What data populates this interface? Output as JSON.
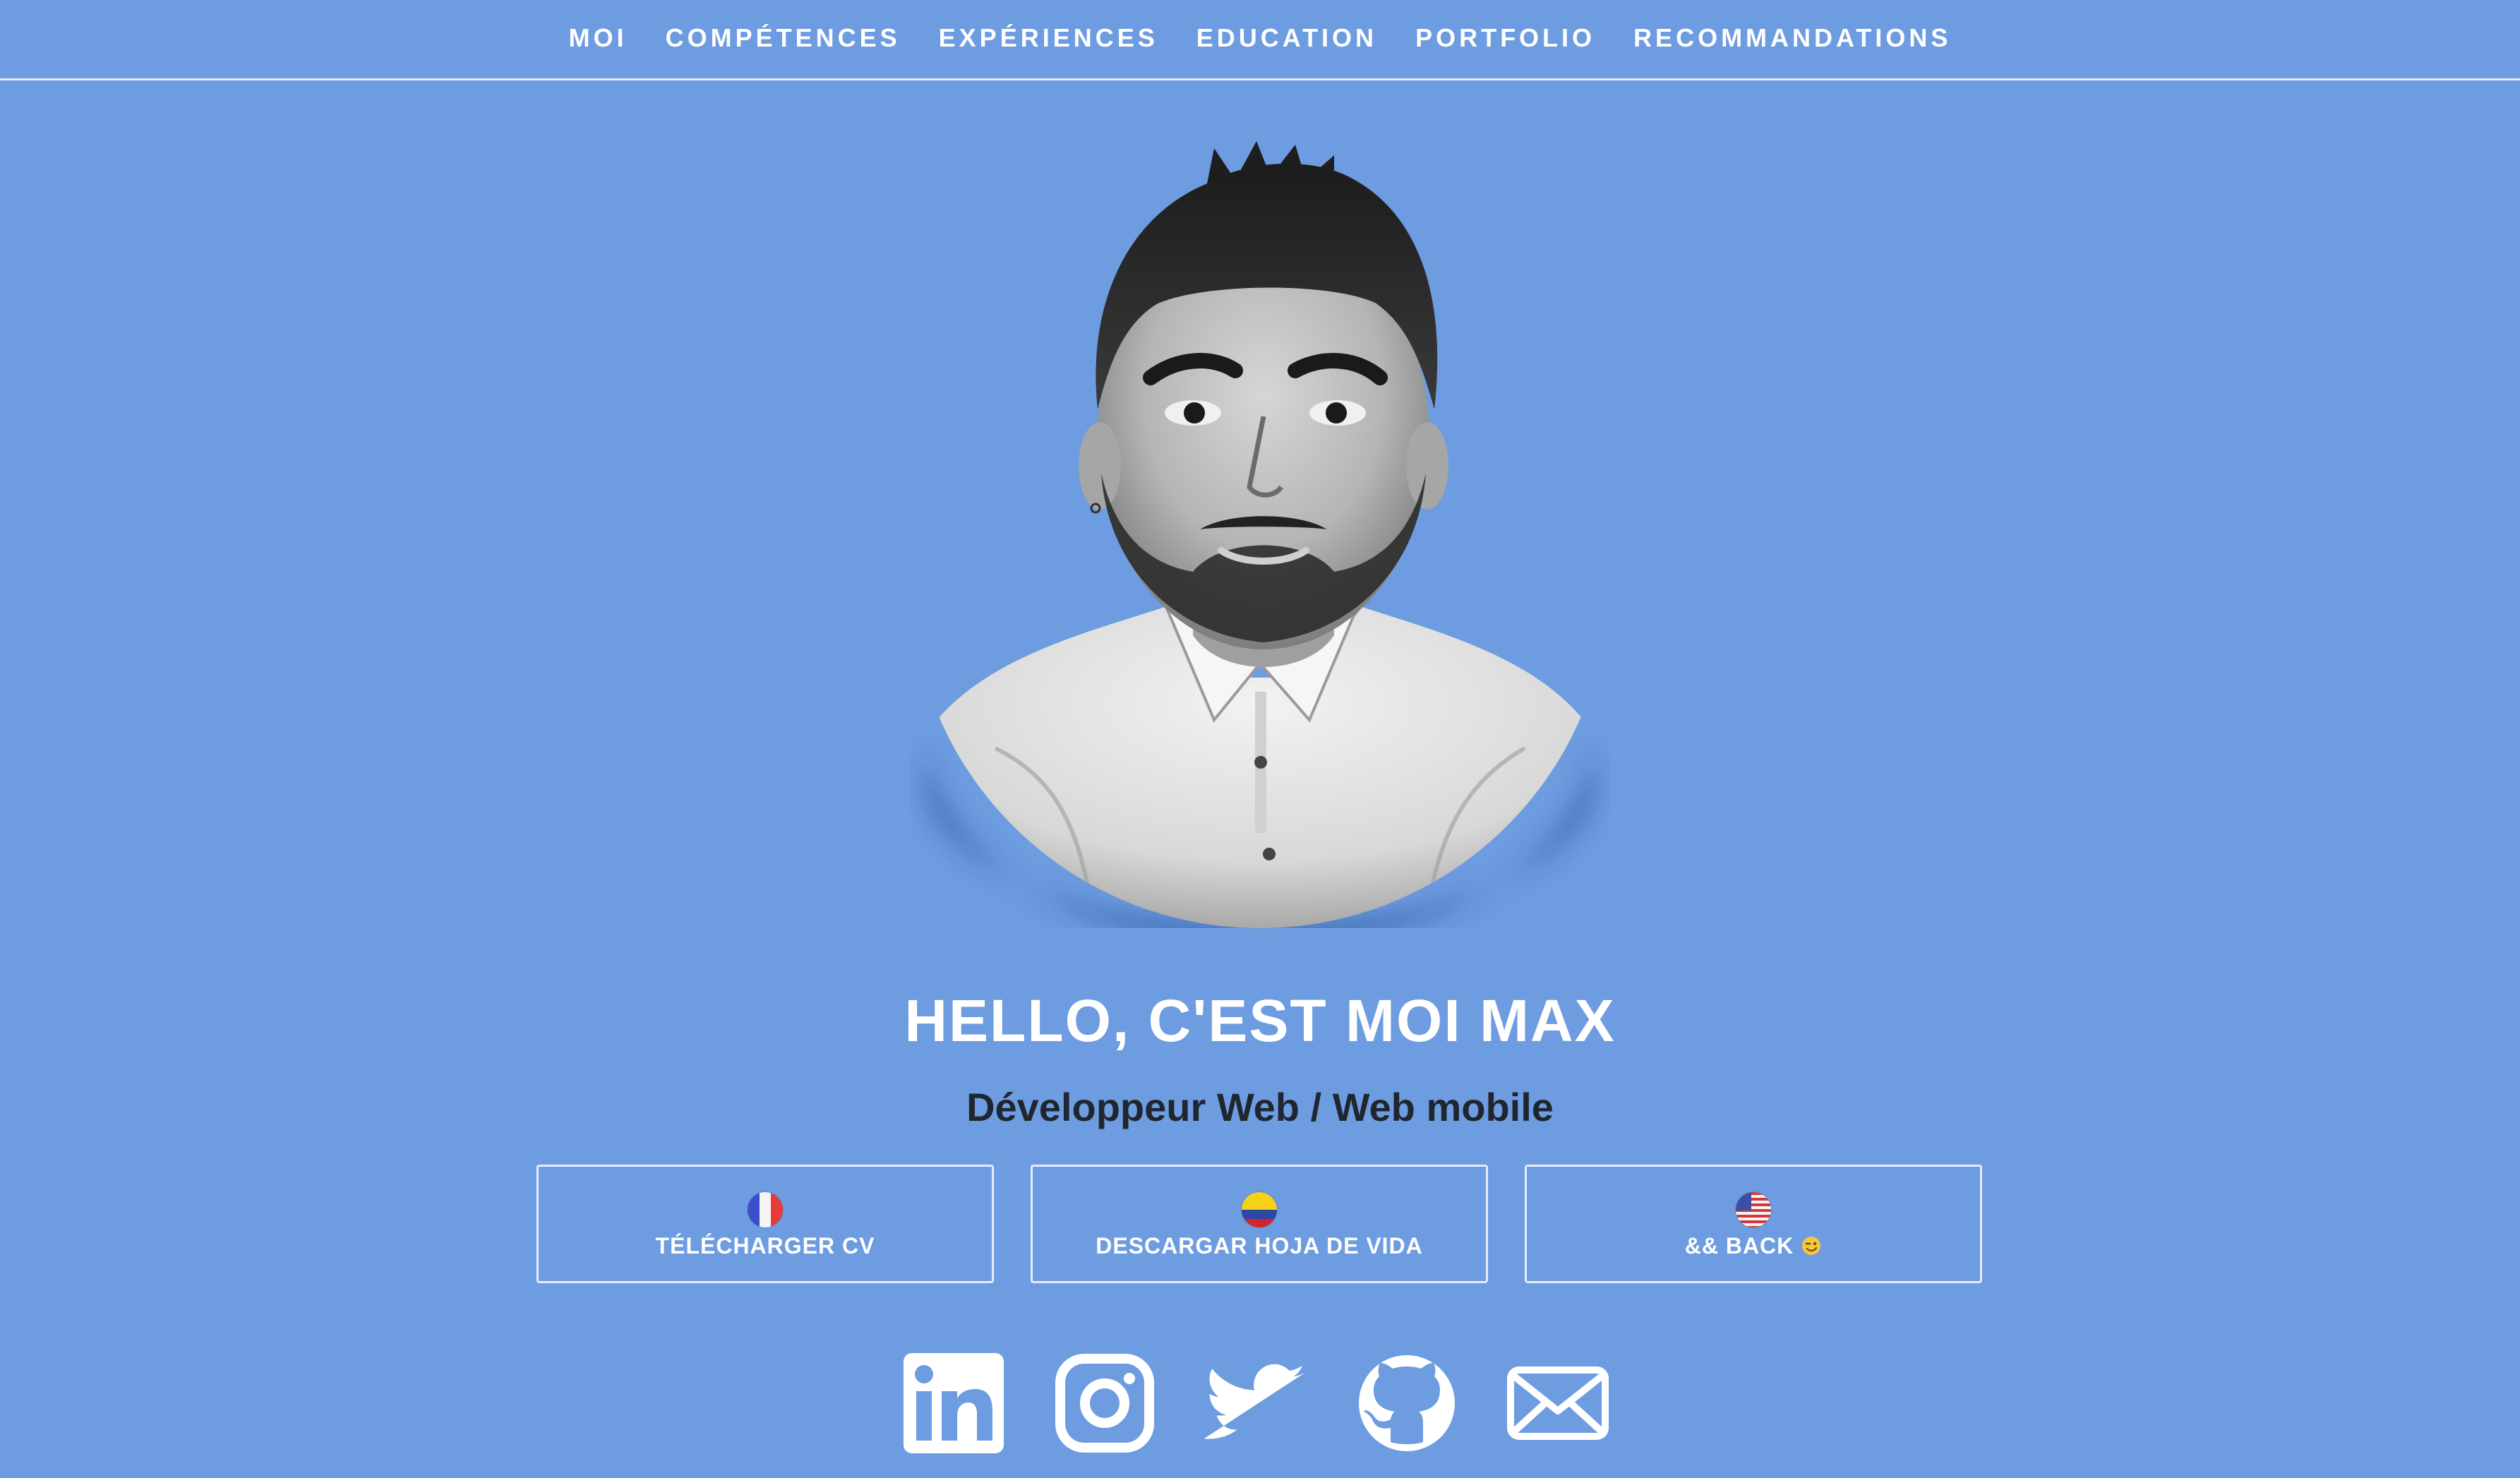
{
  "nav": {
    "items": [
      {
        "label": "MOI"
      },
      {
        "label": "COMPÉTENCES"
      },
      {
        "label": "EXPÉRIENCES"
      },
      {
        "label": "EDUCATION"
      },
      {
        "label": "PORTFOLIO"
      },
      {
        "label": "RECOMMANDATIONS"
      }
    ]
  },
  "hero": {
    "title": "HELLO, C'EST MOI MAX",
    "subtitle": "Développeur Web / Web mobile"
  },
  "cv_buttons": [
    {
      "label": "TÉLÉCHARGER CV",
      "flag": "france-flag-icon"
    },
    {
      "label": "DESCARGAR HOJA DE VIDA",
      "flag": "colombia-flag-icon"
    },
    {
      "label": "&& BACK",
      "flag": "usa-flag-icon",
      "emoji": "wink-emoji-icon"
    }
  ],
  "social": [
    {
      "icon": "linkedin-icon"
    },
    {
      "icon": "instagram-icon"
    },
    {
      "icon": "twitter-icon"
    },
    {
      "icon": "github-icon"
    },
    {
      "icon": "email-icon"
    }
  ],
  "colors": {
    "background": "#6e9ce0",
    "text_light": "#ffffff",
    "text_dark": "#1f2630",
    "border": "#e4ecfa"
  }
}
